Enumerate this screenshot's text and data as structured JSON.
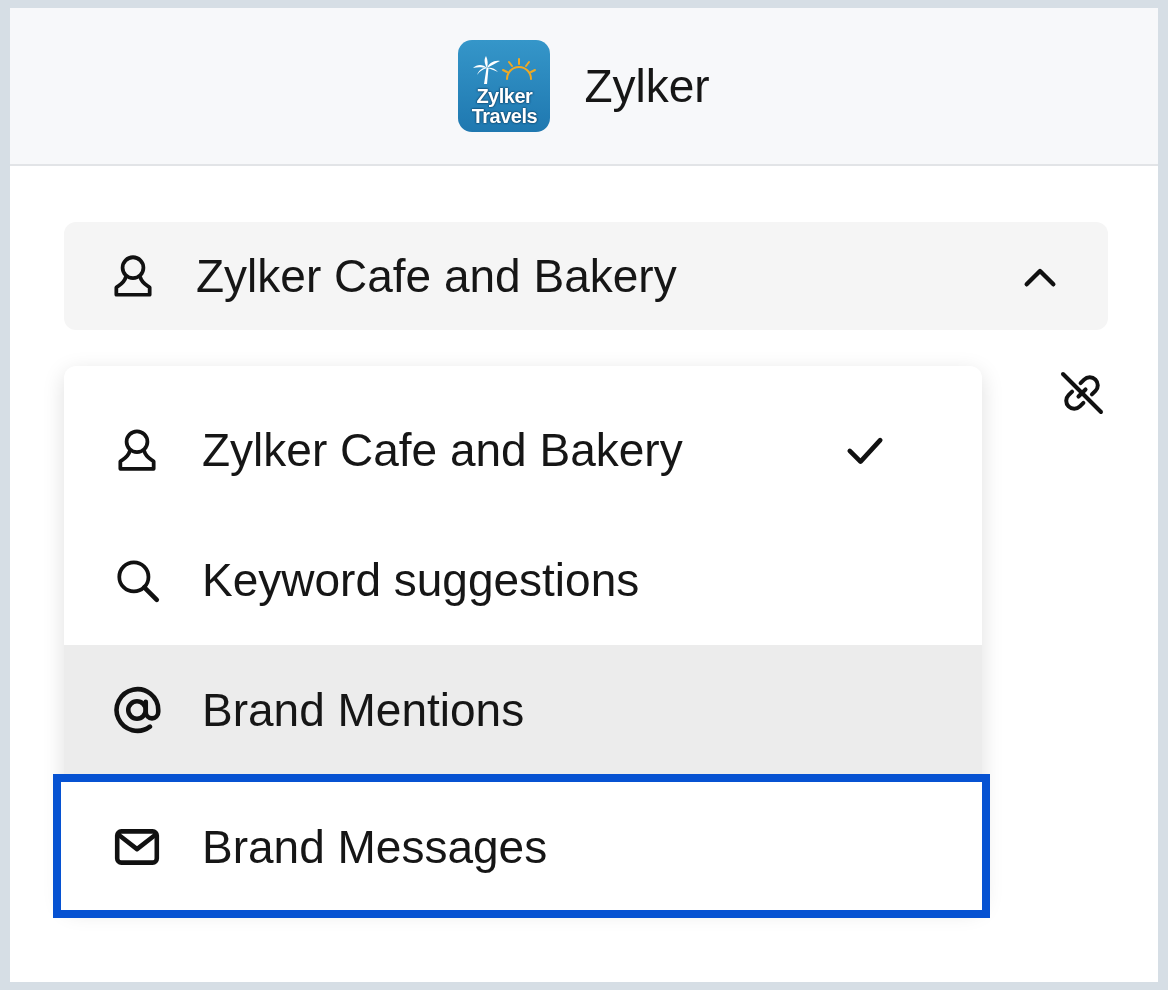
{
  "header": {
    "logo_lines": [
      "Zylker",
      "Travels"
    ],
    "title": "Zylker"
  },
  "account_selector": {
    "label": "Zylker Cafe and Bakery",
    "expanded": true
  },
  "menu": {
    "items": [
      {
        "kind": "account",
        "label": "Zylker Cafe and Bakery",
        "selected": true,
        "hovered": false,
        "highlighted": false
      },
      {
        "kind": "keywords",
        "label": "Keyword suggestions",
        "selected": false,
        "hovered": false,
        "highlighted": false
      },
      {
        "kind": "mentions",
        "label": "Brand Mentions",
        "selected": false,
        "hovered": true,
        "highlighted": false
      },
      {
        "kind": "messages",
        "label": "Brand Messages",
        "selected": false,
        "hovered": false,
        "highlighted": true
      }
    ]
  }
}
